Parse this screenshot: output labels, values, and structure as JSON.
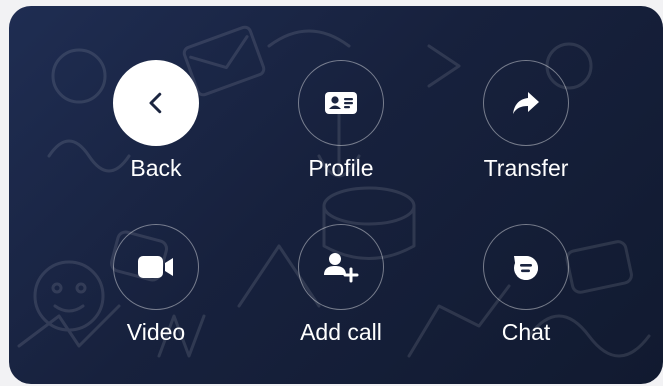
{
  "actions": [
    {
      "id": "back",
      "label": "Back",
      "icon": "chevron-left-icon",
      "active": true
    },
    {
      "id": "profile",
      "label": "Profile",
      "icon": "id-card-icon",
      "active": false
    },
    {
      "id": "transfer",
      "label": "Transfer",
      "icon": "forward-arrow-icon",
      "active": false
    },
    {
      "id": "video",
      "label": "Video",
      "icon": "video-camera-icon",
      "active": false
    },
    {
      "id": "add-call",
      "label": "Add call",
      "icon": "add-person-icon",
      "active": false
    },
    {
      "id": "chat",
      "label": "Chat",
      "icon": "chat-bubble-icon",
      "active": false
    }
  ],
  "colors": {
    "background_start": "#1f2d52",
    "background_end": "#111a30",
    "icon": "#ffffff",
    "active_circle": "#ffffff",
    "active_icon": "#1b2540"
  }
}
